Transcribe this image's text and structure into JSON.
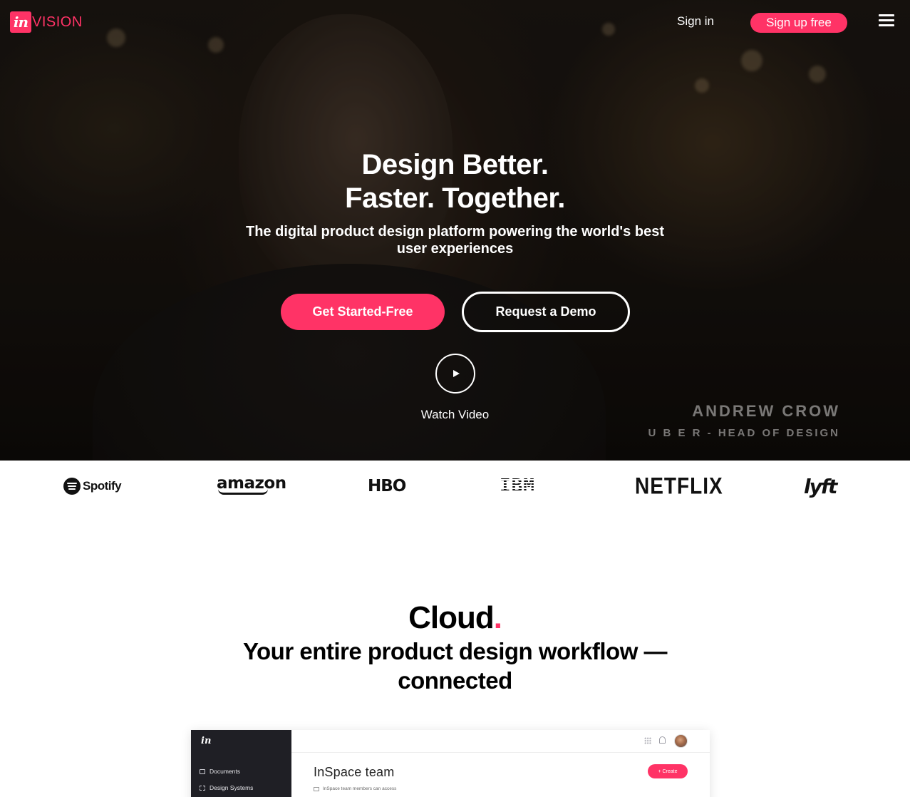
{
  "brand": {
    "logo_mark": "in",
    "logo_word": "VISION",
    "accent_color": "#ff3366"
  },
  "nav": {
    "sign_in": "Sign in",
    "sign_up": "Sign up free",
    "menu_icon": "hamburger-menu-icon"
  },
  "hero": {
    "title_line1": "Design Better.",
    "title_line2": "Faster. Together.",
    "subtitle": "The digital product design platform powering the world's best user experiences",
    "primary_cta": "Get Started-Free",
    "secondary_cta": "Request a Demo",
    "play_icon": "play-icon",
    "watch_label": "Watch Video",
    "credit_name": "ANDREW CROW",
    "credit_role": "U B E R  - HEAD OF DESIGN"
  },
  "logos": {
    "items": [
      "Spotify",
      "amazon",
      "HBO",
      "IBM",
      "NETFLIX",
      "lyft"
    ]
  },
  "cloud": {
    "title": "Cloud",
    "title_dot": ".",
    "subtitle": "Your entire product design workflow —connected"
  },
  "app_preview": {
    "logo": "in",
    "nav_items": [
      "Documents",
      "Design Systems"
    ],
    "team_title": "InSpace team",
    "team_note": "InSpace team members can access",
    "create_label": "+ Create"
  }
}
